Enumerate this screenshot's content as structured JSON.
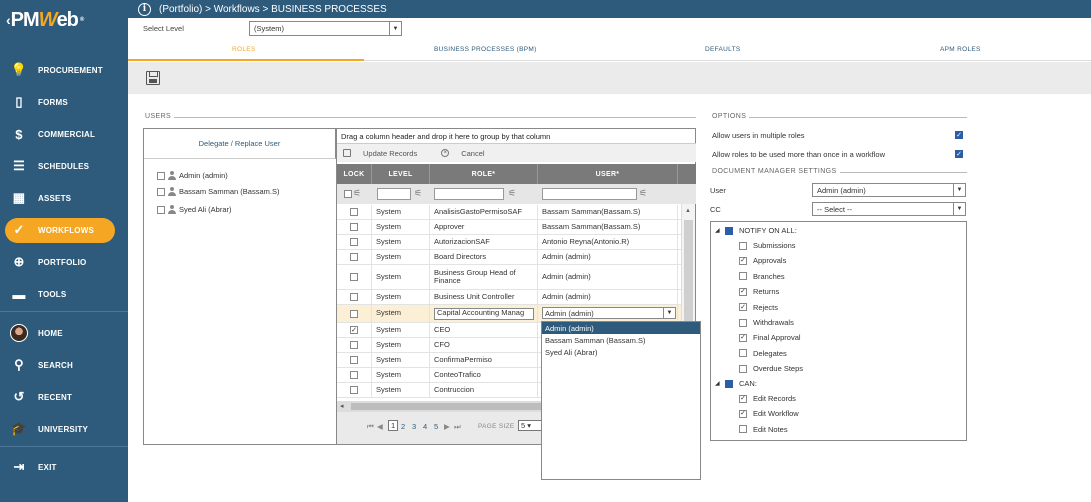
{
  "sidebar": {
    "logo": {
      "prefix": "PM",
      "accent": "W",
      "suffix": "eb",
      "reg": "®"
    },
    "items": [
      {
        "label": "PROCUREMENT",
        "icon": "bulb-icon",
        "glyph": "💡"
      },
      {
        "label": "FORMS",
        "icon": "forms-icon",
        "glyph": "▯"
      },
      {
        "label": "COMMERCIAL",
        "icon": "dollar-icon",
        "glyph": "$"
      },
      {
        "label": "SCHEDULES",
        "icon": "schedule-icon",
        "glyph": "☰"
      },
      {
        "label": "ASSETS",
        "icon": "building-icon",
        "glyph": "▦"
      },
      {
        "label": "WORKFLOWS",
        "icon": "check-icon",
        "glyph": "✓"
      },
      {
        "label": "PORTFOLIO",
        "icon": "globe-icon",
        "glyph": "⊕"
      },
      {
        "label": "TOOLS",
        "icon": "toolbox-icon",
        "glyph": "▬"
      },
      {
        "label": "HOME",
        "icon": "avatar",
        "glyph": ""
      },
      {
        "label": "SEARCH",
        "icon": "search-icon",
        "glyph": "⚲"
      },
      {
        "label": "RECENT",
        "icon": "recent-icon",
        "glyph": "↺"
      },
      {
        "label": "UNIVERSITY",
        "icon": "graduation-icon",
        "glyph": "🎓"
      },
      {
        "label": "EXIT",
        "icon": "exit-icon",
        "glyph": "⇥"
      }
    ]
  },
  "header": {
    "info_glyph": "i",
    "breadcrumb": "(Portfolio) > Workflows > BUSINESS PROCESSES"
  },
  "level": {
    "label": "Select Level",
    "value": "(System)"
  },
  "tabs": [
    "ROLES",
    "BUSINESS PROCESSES (BPM)",
    "DEFAULTS",
    "APM ROLES"
  ],
  "users_section": {
    "title": "USERS",
    "delegate_label": "Delegate / Replace User",
    "users": [
      "Admin (admin)",
      "Bassam Samman (Bassam.S)",
      "Syed Ali (Abrar)"
    ]
  },
  "grid": {
    "group_hint": "Drag a column header and drop it here to group by that column",
    "update_label": "Update Records",
    "cancel_label": "Cancel",
    "columns": [
      "LOCK",
      "LEVEL",
      "ROLE*",
      "USER*"
    ],
    "rows": [
      {
        "lock": false,
        "level": "System",
        "role": "AnalisisGastoPermisoSAF",
        "user": "Bassam Samman(Bassam.S)"
      },
      {
        "lock": false,
        "level": "System",
        "role": "Approver",
        "user": "Bassam Samman(Bassam.S)"
      },
      {
        "lock": false,
        "level": "System",
        "role": "AutorizacionSAF",
        "user": "Antonio Reyna(Antonio.R)"
      },
      {
        "lock": false,
        "level": "System",
        "role": "Board Directors",
        "user": "Admin (admin)"
      },
      {
        "lock": false,
        "level": "System",
        "role": "Business Group Head of Finance",
        "user": "Admin (admin)"
      },
      {
        "lock": false,
        "level": "System",
        "role": "Business Unit Controller",
        "user": "Admin (admin)"
      },
      {
        "lock": false,
        "level": "System",
        "role": "Capital Accounting Manag",
        "user": "Admin  (admin)"
      },
      {
        "lock": true,
        "level": "System",
        "role": "CEO",
        "user": ""
      },
      {
        "lock": false,
        "level": "System",
        "role": "CFO",
        "user": ""
      },
      {
        "lock": false,
        "level": "System",
        "role": "ConfirmaPermiso",
        "user": ""
      },
      {
        "lock": false,
        "level": "System",
        "role": "ConteoTrafico",
        "user": ""
      },
      {
        "lock": false,
        "level": "System",
        "role": "Contruccion",
        "user": ""
      }
    ],
    "pager": {
      "pages": [
        "1",
        "2",
        "3",
        "4",
        "5"
      ],
      "page_size_label": "PAGE SIZE",
      "page_size": "5"
    },
    "user_options": [
      "Admin (admin)",
      "Bassam Samman (Bassam.S)",
      "Syed Ali (Abrar)"
    ]
  },
  "options": {
    "title": "OPTIONS",
    "allow_multiple": "Allow users in multiple roles",
    "allow_roles_once": "Allow roles to be used more than once in a workflow",
    "doc_manager_title": "DOCUMENT MANAGER SETTINGS",
    "user_label": "User",
    "user_value": "Admin  (admin)",
    "cc_label": "CC",
    "cc_value": "-- Select --",
    "notify_label": "NOTIFY ON ALL:",
    "notify_items": [
      {
        "label": "Submissions",
        "checked": false
      },
      {
        "label": "Approvals",
        "checked": true
      },
      {
        "label": "Branches",
        "checked": false
      },
      {
        "label": "Returns",
        "checked": true
      },
      {
        "label": "Rejects",
        "checked": true
      },
      {
        "label": "Withdrawals",
        "checked": false
      },
      {
        "label": "Final Approval",
        "checked": true
      },
      {
        "label": "Delegates",
        "checked": false
      },
      {
        "label": "Overdue Steps",
        "checked": false
      }
    ],
    "can_label": "CAN:",
    "can_items": [
      {
        "label": "Edit Records",
        "checked": true
      },
      {
        "label": "Edit Workflow",
        "checked": true
      },
      {
        "label": "Edit Notes",
        "checked": false
      }
    ]
  },
  "colors": {
    "sidebar": "#2e5b7b",
    "accent": "#f5a623",
    "check": "#2c5ea8"
  }
}
